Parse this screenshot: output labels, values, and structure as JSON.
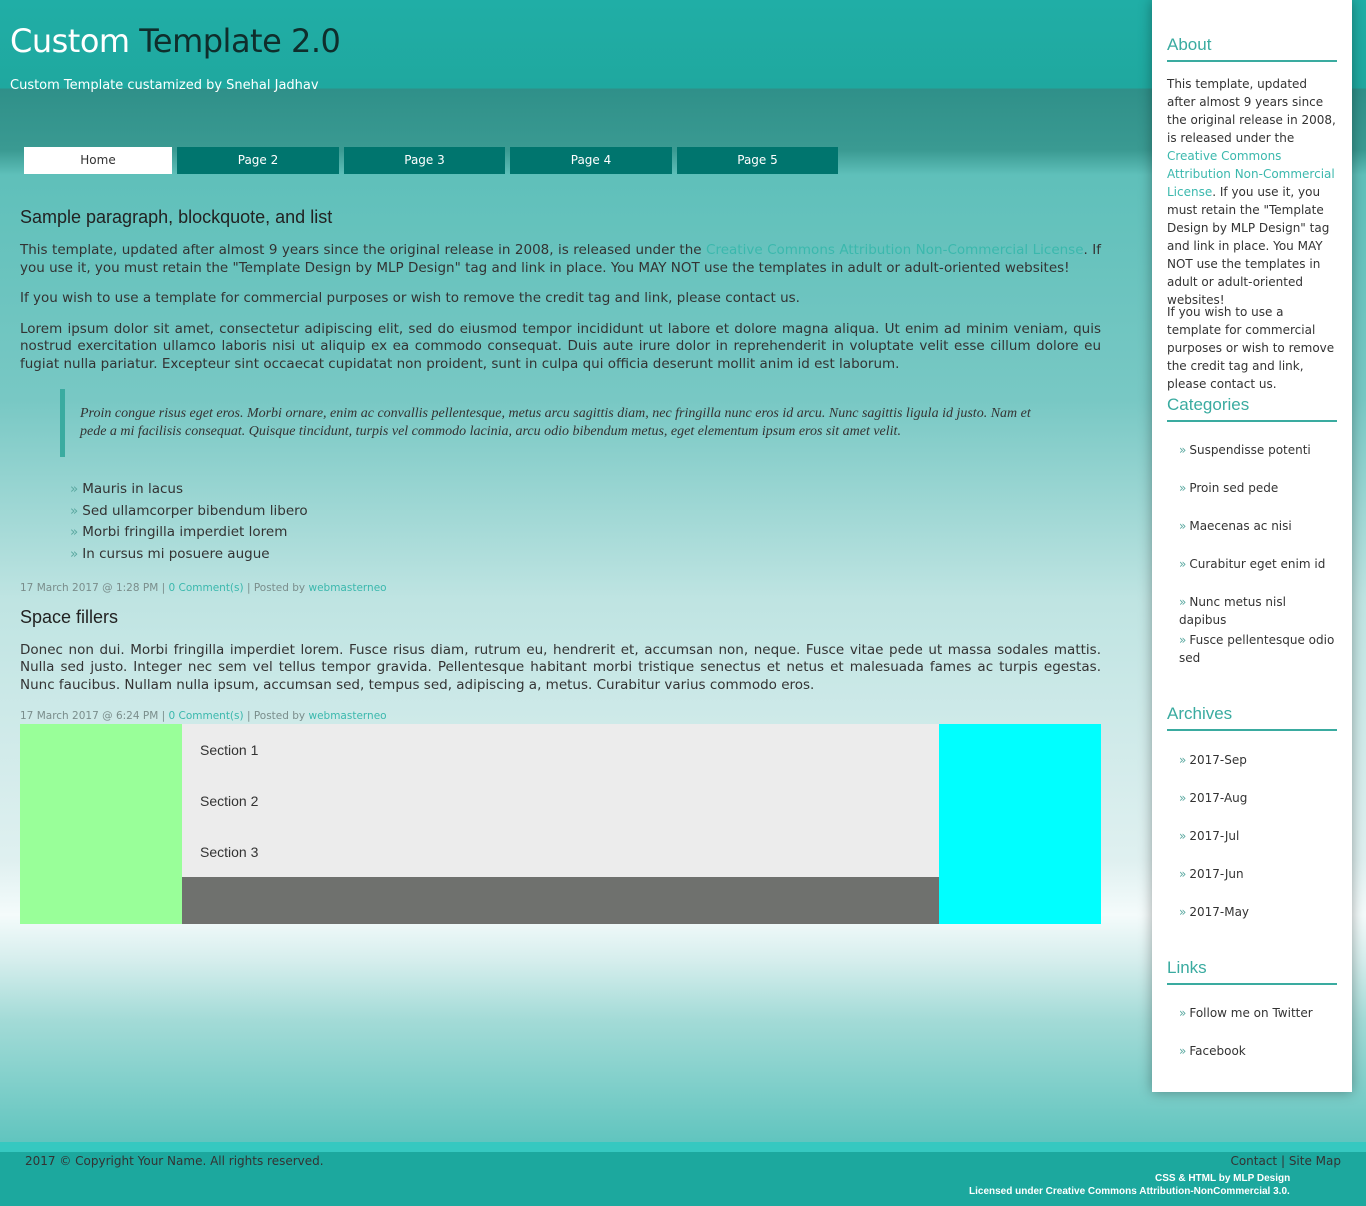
{
  "header": {
    "title_part1": "Custom",
    "title_part2": " Template 2.0",
    "tagline": "Custom Template custamized by Snehal Jadhav"
  },
  "nav": {
    "items": [
      "Home",
      "Page 2",
      "Page 3",
      "Page 4",
      "Page 5"
    ],
    "active": "Home"
  },
  "posts": [
    {
      "title": "Sample paragraph, blockquote, and list",
      "p1_before": "This template, updated after almost 9 years since the original release in 2008, is released under the ",
      "p1_link": "Creative Commons Attribution Non-Commercial License",
      "p1_after": ". If you use it, you must retain the \"Template Design by MLP Design\" tag and link in place. You MAY NOT use the templates in adult or adult-oriented websites!",
      "p2": "If you wish to use a template for commercial purposes or wish to remove the credit tag and link, please contact us.",
      "p3": "Lorem ipsum dolor sit amet, consectetur adipiscing elit, sed do eiusmod tempor incididunt ut labore et dolore magna aliqua. Ut enim ad minim veniam, quis nostrud exercitation ullamco laboris nisi ut aliquip ex ea commodo consequat. Duis aute irure dolor in reprehenderit in voluptate velit esse cillum dolore eu fugiat nulla pariatur. Excepteur sint occaecat cupidatat non proident, sunt in culpa qui officia deserunt mollit anim id est laborum.",
      "blockquote": "Proin congue risus eget eros. Morbi ornare, enim ac convallis pellentesque, metus arcu sagittis diam, nec fringilla nunc eros id arcu. Nunc sagittis ligula id justo. Nam et pede a mi facilisis consequat. Quisque tincidunt, turpis vel commodo lacinia, arcu odio bibendum metus, eget elementum ipsum eros sit amet velit.",
      "list": [
        "Mauris in lacus",
        "Sed ullamcorper bibendum libero",
        "Morbi fringilla imperdiet lorem",
        "In cursus mi posuere augue"
      ],
      "meta_date": "17 March 2017 @ 1:28 PM",
      "meta_sep1": " | ",
      "meta_comments": "0 Comment(s)",
      "meta_posted": " | Posted by ",
      "meta_author": "webmasterneo"
    },
    {
      "title": "Space fillers",
      "p1": "Donec non dui. Morbi fringilla imperdiet lorem. Fusce risus diam, rutrum eu, hendrerit et, accumsan non, neque. Fusce vitae pede ut massa sodales mattis. Nulla sed justo. Integer nec sem vel tellus tempor gravida. Pellentesque habitant morbi tristique senectus et netus et malesuada fames ac turpis egestas. Nunc faucibus. Nullam nulla ipsum, accumsan sed, tempus sed, adipiscing a, metus. Curabitur varius commodo eros.",
      "meta_date": "17 March 2017 @ 6:24 PM",
      "meta_sep1": " | ",
      "meta_comments": "0 Comment(s)",
      "meta_posted": " | Posted by ",
      "meta_author": "webmasterneo"
    }
  ],
  "sections": [
    "Section 1",
    "Section 2",
    "Section 3"
  ],
  "sidebar": {
    "about_title": "About",
    "about_p1_before": "This template, updated after almost 9 years since the original release in 2008, is released under the ",
    "about_p1_link": "Creative Commons Attribution Non-Commercial License",
    "about_p1_after": ". If you use it, you must retain the \"Template Design by MLP Design\" tag and link in place. You MAY NOT use the templates in adult or adult-oriented websites!",
    "about_p2": "If you wish to use a template for commercial purposes or wish to remove the credit tag and link, please contact us.",
    "categories_title": "Categories",
    "categories": [
      "Suspendisse potenti",
      "Proin sed pede",
      "Maecenas ac nisi",
      "Curabitur eget enim id",
      "Nunc metus nisl dapibus",
      "Fusce pellentesque odio sed"
    ],
    "archives_title": "Archives",
    "archives": [
      "2017-Sep",
      "2017-Aug",
      "2017-Jul",
      "2017-Jun",
      "2017-May"
    ],
    "links_title": "Links",
    "links": [
      "Follow me on Twitter",
      "Facebook"
    ]
  },
  "footer": {
    "copyright": "2017 © Copyright Your Name. All rights reserved.",
    "contact": "Contact",
    "separator": " | ",
    "sitemap": "Site Map",
    "credit_line1": "CSS & HTML by MLP Design",
    "credit_line2": "Licensed under Creative Commons Attribution-NonCommercial 3.0."
  },
  "colors": {
    "accent": "#3aaba0",
    "nav_bg": "#00756e",
    "section_left": "#99ff99",
    "section_mid": "#ececec",
    "section_bottom": "#6f716e",
    "section_right": "#00ffff"
  },
  "icons": {
    "list_bullet": "raquo"
  }
}
